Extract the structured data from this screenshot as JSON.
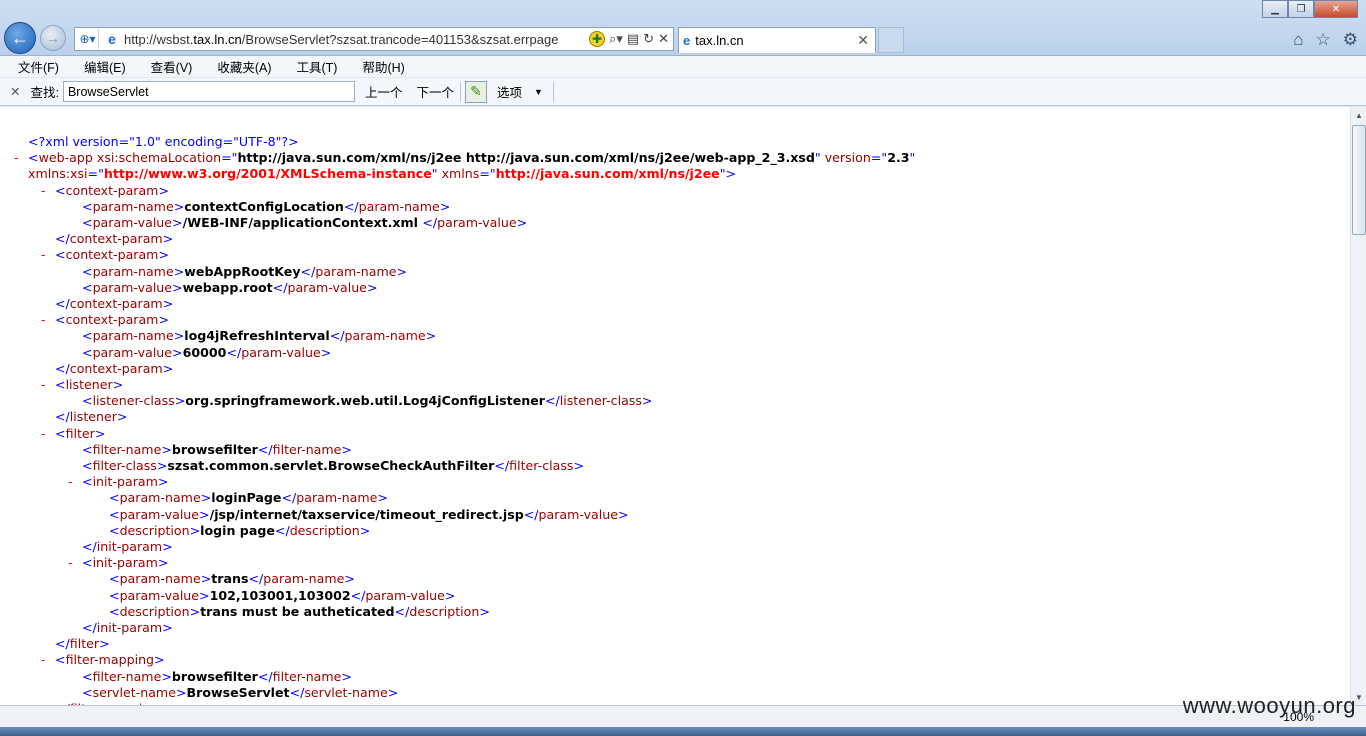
{
  "window": {
    "url_prefix": "http://wsbst.",
    "url_host": "tax.ln.cn",
    "url_rest": "/BrowseServlet?szsat.trancode=401153&szsat.errpage",
    "tab_title": "tax.ln.cn"
  },
  "menu": [
    "文件(F)",
    "编辑(E)",
    "查看(V)",
    "收藏夹(A)",
    "工具(T)",
    "帮助(H)"
  ],
  "find": {
    "label": "查找:",
    "value": "BrowseServlet",
    "prev": "上一个",
    "next": "下一个",
    "options": "选项"
  },
  "xml": [
    {
      "indent": 0,
      "minus": false,
      "parts": [
        [
          "pi",
          "<?xml version=\"1.0\" encoding=\"UTF-8\"?>"
        ]
      ]
    },
    {
      "indent": 0,
      "minus": true,
      "parts": [
        [
          "pi",
          "<"
        ],
        [
          "t",
          "web-app"
        ],
        [
          "a",
          " xsi:schemaLocation"
        ],
        [
          "pi",
          "=\""
        ],
        [
          "v",
          "http://java.sun.com/xml/ns/j2ee http://java.sun.com/xml/ns/j2ee/web-app_2_3.xsd"
        ],
        [
          "pi",
          "\""
        ],
        [
          "a",
          " version"
        ],
        [
          "pi",
          "=\""
        ],
        [
          "v",
          "2.3"
        ],
        [
          "pi",
          "\""
        ]
      ]
    },
    {
      "indent": 0,
      "minus": false,
      "parts": [
        [
          "a",
          "xmlns:xsi"
        ],
        [
          "pi",
          "=\""
        ],
        [
          "av",
          "http://www.w3.org/2001/XMLSchema-instance"
        ],
        [
          "pi",
          "\""
        ],
        [
          "a",
          " xmlns"
        ],
        [
          "pi",
          "=\""
        ],
        [
          "av",
          "http://java.sun.com/xml/ns/j2ee"
        ],
        [
          "pi",
          "\">"
        ]
      ]
    },
    {
      "indent": 1,
      "minus": true,
      "parts": [
        [
          "pi",
          "<"
        ],
        [
          "t",
          "context-param"
        ],
        [
          "pi",
          ">"
        ]
      ]
    },
    {
      "indent": 2,
      "minus": false,
      "parts": [
        [
          "pi",
          "<"
        ],
        [
          "t",
          "param-name"
        ],
        [
          "pi",
          ">"
        ],
        [
          "v",
          "contextConfigLocation"
        ],
        [
          "pi",
          "</"
        ],
        [
          "t",
          "param-name"
        ],
        [
          "pi",
          ">"
        ]
      ]
    },
    {
      "indent": 2,
      "minus": false,
      "parts": [
        [
          "pi",
          "<"
        ],
        [
          "t",
          "param-value"
        ],
        [
          "pi",
          ">"
        ],
        [
          "v",
          "/WEB-INF/applicationContext.xml "
        ],
        [
          "pi",
          "</"
        ],
        [
          "t",
          "param-value"
        ],
        [
          "pi",
          ">"
        ]
      ]
    },
    {
      "indent": 1,
      "minus": false,
      "parts": [
        [
          "pi",
          "</"
        ],
        [
          "t",
          "context-param"
        ],
        [
          "pi",
          ">"
        ]
      ]
    },
    {
      "indent": 1,
      "minus": true,
      "parts": [
        [
          "pi",
          "<"
        ],
        [
          "t",
          "context-param"
        ],
        [
          "pi",
          ">"
        ]
      ]
    },
    {
      "indent": 2,
      "minus": false,
      "parts": [
        [
          "pi",
          "<"
        ],
        [
          "t",
          "param-name"
        ],
        [
          "pi",
          ">"
        ],
        [
          "v",
          "webAppRootKey"
        ],
        [
          "pi",
          "</"
        ],
        [
          "t",
          "param-name"
        ],
        [
          "pi",
          ">"
        ]
      ]
    },
    {
      "indent": 2,
      "minus": false,
      "parts": [
        [
          "pi",
          "<"
        ],
        [
          "t",
          "param-value"
        ],
        [
          "pi",
          ">"
        ],
        [
          "v",
          "webapp.root"
        ],
        [
          "pi",
          "</"
        ],
        [
          "t",
          "param-value"
        ],
        [
          "pi",
          ">"
        ]
      ]
    },
    {
      "indent": 1,
      "minus": false,
      "parts": [
        [
          "pi",
          "</"
        ],
        [
          "t",
          "context-param"
        ],
        [
          "pi",
          ">"
        ]
      ]
    },
    {
      "indent": 1,
      "minus": true,
      "parts": [
        [
          "pi",
          "<"
        ],
        [
          "t",
          "context-param"
        ],
        [
          "pi",
          ">"
        ]
      ]
    },
    {
      "indent": 2,
      "minus": false,
      "parts": [
        [
          "pi",
          "<"
        ],
        [
          "t",
          "param-name"
        ],
        [
          "pi",
          ">"
        ],
        [
          "v",
          "log4jRefreshInterval"
        ],
        [
          "pi",
          "</"
        ],
        [
          "t",
          "param-name"
        ],
        [
          "pi",
          ">"
        ]
      ]
    },
    {
      "indent": 2,
      "minus": false,
      "parts": [
        [
          "pi",
          "<"
        ],
        [
          "t",
          "param-value"
        ],
        [
          "pi",
          ">"
        ],
        [
          "v",
          "60000"
        ],
        [
          "pi",
          "</"
        ],
        [
          "t",
          "param-value"
        ],
        [
          "pi",
          ">"
        ]
      ]
    },
    {
      "indent": 1,
      "minus": false,
      "parts": [
        [
          "pi",
          "</"
        ],
        [
          "t",
          "context-param"
        ],
        [
          "pi",
          ">"
        ]
      ]
    },
    {
      "indent": 1,
      "minus": true,
      "parts": [
        [
          "pi",
          "<"
        ],
        [
          "t",
          "listener"
        ],
        [
          "pi",
          ">"
        ]
      ]
    },
    {
      "indent": 2,
      "minus": false,
      "parts": [
        [
          "pi",
          "<"
        ],
        [
          "t",
          "listener-class"
        ],
        [
          "pi",
          ">"
        ],
        [
          "v",
          "org.springframework.web.util.Log4jConfigListener"
        ],
        [
          "pi",
          "</"
        ],
        [
          "t",
          "listener-class"
        ],
        [
          "pi",
          ">"
        ]
      ]
    },
    {
      "indent": 1,
      "minus": false,
      "parts": [
        [
          "pi",
          "</"
        ],
        [
          "t",
          "listener"
        ],
        [
          "pi",
          ">"
        ]
      ]
    },
    {
      "indent": 1,
      "minus": true,
      "parts": [
        [
          "pi",
          "<"
        ],
        [
          "t",
          "filter"
        ],
        [
          "pi",
          ">"
        ]
      ]
    },
    {
      "indent": 2,
      "minus": false,
      "parts": [
        [
          "pi",
          "<"
        ],
        [
          "t",
          "filter-name"
        ],
        [
          "pi",
          ">"
        ],
        [
          "v",
          "browsefilter"
        ],
        [
          "pi",
          "</"
        ],
        [
          "t",
          "filter-name"
        ],
        [
          "pi",
          ">"
        ]
      ]
    },
    {
      "indent": 2,
      "minus": false,
      "parts": [
        [
          "pi",
          "<"
        ],
        [
          "t",
          "filter-class"
        ],
        [
          "pi",
          ">"
        ],
        [
          "v",
          "szsat.common.servlet.BrowseCheckAuthFilter"
        ],
        [
          "pi",
          "</"
        ],
        [
          "t",
          "filter-class"
        ],
        [
          "pi",
          ">"
        ]
      ]
    },
    {
      "indent": 2,
      "minus": true,
      "parts": [
        [
          "pi",
          "<"
        ],
        [
          "t",
          "init-param"
        ],
        [
          "pi",
          ">"
        ]
      ]
    },
    {
      "indent": 3,
      "minus": false,
      "parts": [
        [
          "pi",
          "<"
        ],
        [
          "t",
          "param-name"
        ],
        [
          "pi",
          ">"
        ],
        [
          "v",
          "loginPage"
        ],
        [
          "pi",
          "</"
        ],
        [
          "t",
          "param-name"
        ],
        [
          "pi",
          ">"
        ]
      ]
    },
    {
      "indent": 3,
      "minus": false,
      "parts": [
        [
          "pi",
          "<"
        ],
        [
          "t",
          "param-value"
        ],
        [
          "pi",
          ">"
        ],
        [
          "v",
          "/jsp/internet/taxservice/timeout_redirect.jsp"
        ],
        [
          "pi",
          "</"
        ],
        [
          "t",
          "param-value"
        ],
        [
          "pi",
          ">"
        ]
      ]
    },
    {
      "indent": 3,
      "minus": false,
      "parts": [
        [
          "pi",
          "<"
        ],
        [
          "t",
          "description"
        ],
        [
          "pi",
          ">"
        ],
        [
          "v",
          "login page"
        ],
        [
          "pi",
          "</"
        ],
        [
          "t",
          "description"
        ],
        [
          "pi",
          ">"
        ]
      ]
    },
    {
      "indent": 2,
      "minus": false,
      "parts": [
        [
          "pi",
          "</"
        ],
        [
          "t",
          "init-param"
        ],
        [
          "pi",
          ">"
        ]
      ]
    },
    {
      "indent": 2,
      "minus": true,
      "parts": [
        [
          "pi",
          "<"
        ],
        [
          "t",
          "init-param"
        ],
        [
          "pi",
          ">"
        ]
      ]
    },
    {
      "indent": 3,
      "minus": false,
      "parts": [
        [
          "pi",
          "<"
        ],
        [
          "t",
          "param-name"
        ],
        [
          "pi",
          ">"
        ],
        [
          "v",
          "trans"
        ],
        [
          "pi",
          "</"
        ],
        [
          "t",
          "param-name"
        ],
        [
          "pi",
          ">"
        ]
      ]
    },
    {
      "indent": 3,
      "minus": false,
      "parts": [
        [
          "pi",
          "<"
        ],
        [
          "t",
          "param-value"
        ],
        [
          "pi",
          ">"
        ],
        [
          "v",
          "102,103001,103002"
        ],
        [
          "pi",
          "</"
        ],
        [
          "t",
          "param-value"
        ],
        [
          "pi",
          ">"
        ]
      ]
    },
    {
      "indent": 3,
      "minus": false,
      "parts": [
        [
          "pi",
          "<"
        ],
        [
          "t",
          "description"
        ],
        [
          "pi",
          ">"
        ],
        [
          "v",
          "trans must be autheticated"
        ],
        [
          "pi",
          "</"
        ],
        [
          "t",
          "description"
        ],
        [
          "pi",
          ">"
        ]
      ]
    },
    {
      "indent": 2,
      "minus": false,
      "parts": [
        [
          "pi",
          "</"
        ],
        [
          "t",
          "init-param"
        ],
        [
          "pi",
          ">"
        ]
      ]
    },
    {
      "indent": 1,
      "minus": false,
      "parts": [
        [
          "pi",
          "</"
        ],
        [
          "t",
          "filter"
        ],
        [
          "pi",
          ">"
        ]
      ]
    },
    {
      "indent": 1,
      "minus": true,
      "parts": [
        [
          "pi",
          "<"
        ],
        [
          "t",
          "filter-mapping"
        ],
        [
          "pi",
          ">"
        ]
      ]
    },
    {
      "indent": 2,
      "minus": false,
      "parts": [
        [
          "pi",
          "<"
        ],
        [
          "t",
          "filter-name"
        ],
        [
          "pi",
          ">"
        ],
        [
          "v",
          "browsefilter"
        ],
        [
          "pi",
          "</"
        ],
        [
          "t",
          "filter-name"
        ],
        [
          "pi",
          ">"
        ]
      ]
    },
    {
      "indent": 2,
      "minus": false,
      "parts": [
        [
          "pi",
          "<"
        ],
        [
          "t",
          "servlet-name"
        ],
        [
          "pi",
          ">"
        ],
        [
          "v",
          "BrowseServlet"
        ],
        [
          "pi",
          "</"
        ],
        [
          "t",
          "servlet-name"
        ],
        [
          "pi",
          ">"
        ]
      ]
    },
    {
      "indent": 1,
      "minus": false,
      "parts": [
        [
          "pi",
          "</"
        ],
        [
          "t",
          "filter-mapping"
        ],
        [
          "pi",
          ">"
        ]
      ]
    }
  ],
  "status": {
    "zoom": "100%"
  },
  "watermark": "www.wooyun.org",
  "colors": {
    "tag": "#990000",
    "punct": "#0000ff",
    "value": "#000000",
    "attr_value": "#ff0000",
    "minus": "#ff0000"
  }
}
